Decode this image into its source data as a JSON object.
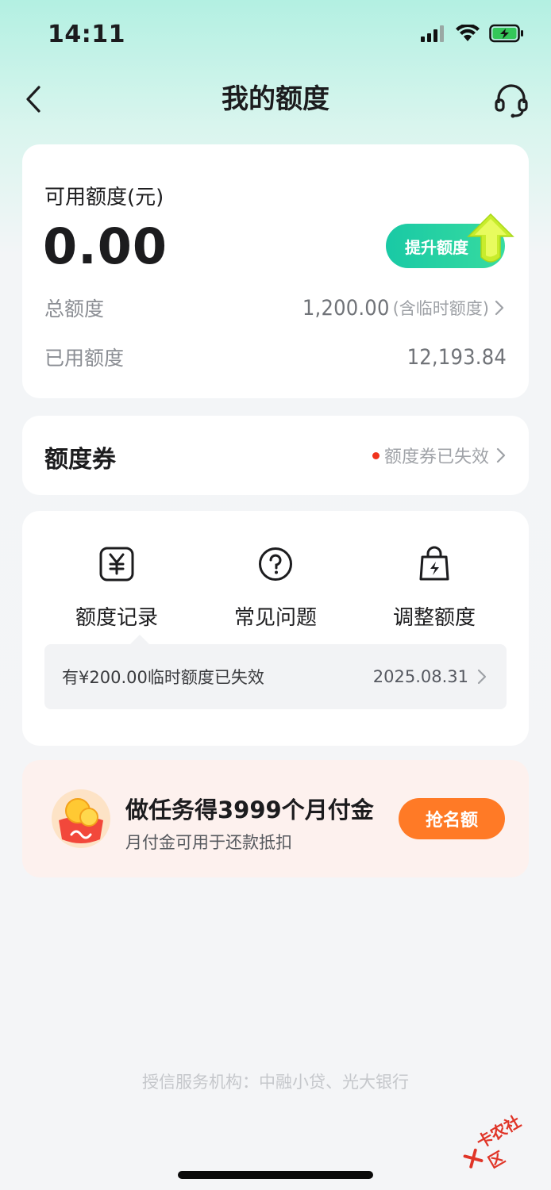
{
  "status_bar": {
    "time": "14:11"
  },
  "nav": {
    "title": "我的额度",
    "back_icon": "chevron-left-icon",
    "service_icon": "headset-icon"
  },
  "quota": {
    "available_label": "可用额度(元)",
    "available_value": "0.00",
    "raise_button": "提升额度",
    "total_label": "总额度",
    "total_value": "1,200.00",
    "total_note": "(含临时额度)",
    "used_label": "已用额度",
    "used_value": "12,193.84"
  },
  "voucher": {
    "title": "额度券",
    "status": "额度券已失效"
  },
  "actions": {
    "items": [
      {
        "label": "额度记录",
        "icon": "yuan-receipt-icon"
      },
      {
        "label": "常见问题",
        "icon": "question-circle-icon"
      },
      {
        "label": "调整额度",
        "icon": "bag-lightning-icon"
      }
    ],
    "tip_text": "有¥200.00临时额度已失效",
    "tip_date": "2025.08.31"
  },
  "promo": {
    "title": "做任务得3999个月付金",
    "subtitle": "月付金可用于还款抵扣",
    "button": "抢名额"
  },
  "footer": {
    "text": "授信服务机构：中融小贷、光大银行"
  },
  "watermark": {
    "text": "卡农社区"
  },
  "colors": {
    "accent_green": "#19c9a5",
    "promo_orange": "#ff7a26",
    "alert_red": "#f0331c"
  }
}
